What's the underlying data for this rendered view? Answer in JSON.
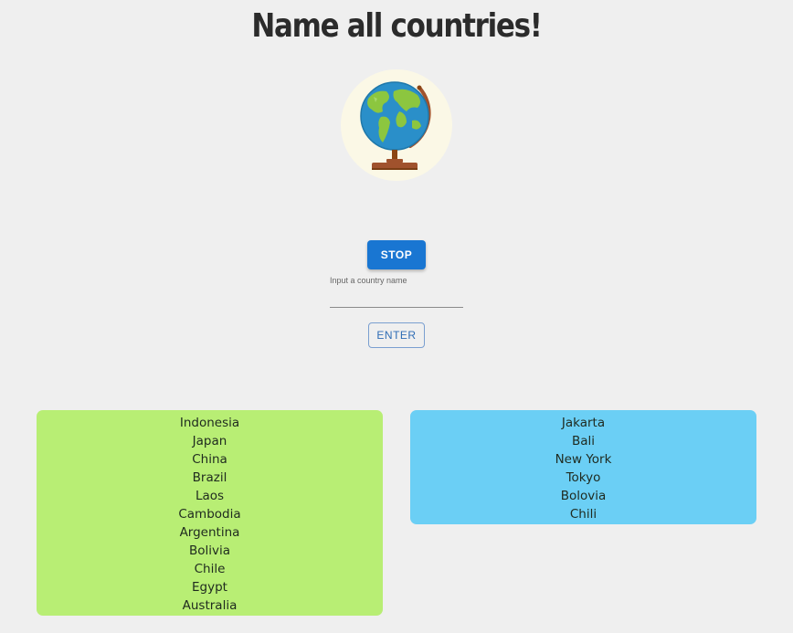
{
  "header": {
    "title": "Name all countries!"
  },
  "controls": {
    "stop_label": "STOP",
    "input_label": "Input a country name",
    "input_value": "",
    "enter_label": "ENTER"
  },
  "correct_list": {
    "color": "#b8ee74",
    "items": [
      "Indonesia",
      "Japan",
      "China",
      "Brazil",
      "Laos",
      "Cambodia",
      "Argentina",
      "Bolivia",
      "Chile",
      "Egypt",
      "Australia"
    ]
  },
  "wrong_list": {
    "color": "#6bcff5",
    "items": [
      "Jakarta",
      "Bali",
      "New York",
      "Tokyo",
      "Bolovia",
      "Chili"
    ]
  },
  "icons": {
    "globe": "globe-icon"
  },
  "colors": {
    "primary": "#1976d2",
    "background": "#efefef"
  }
}
